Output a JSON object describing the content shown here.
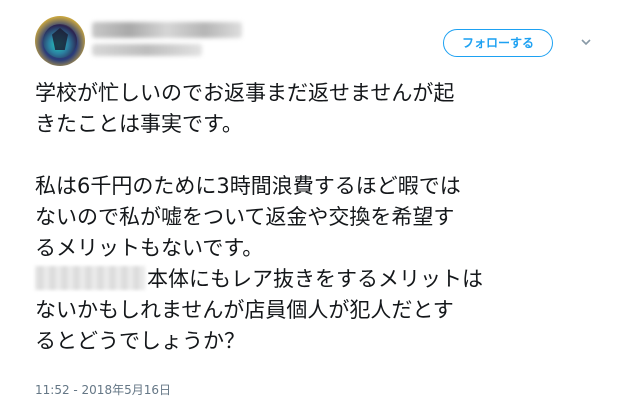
{
  "header": {
    "follow_label": "フォローする",
    "caret_icon": "chevron-down-icon"
  },
  "tweet": {
    "lines": [
      "学校が忙しいのでお返事まだ返せませんが起",
      "きたことは事実です。",
      "",
      "私は6千円のために3時間浪費するほど暇では",
      "ないので私が嘘をついて返金や交換を希望す",
      "るメリットもないです。",
      "本体にもレア抜きをするメリットは",
      "ないかもしれませんが店員個人が犯人だとす",
      "るとどうでしょうか？"
    ],
    "timestamp": "11:52 - 2018年5月16日"
  },
  "colors": {
    "accent": "#1da1f2",
    "text": "#14171a",
    "muted": "#657786"
  }
}
